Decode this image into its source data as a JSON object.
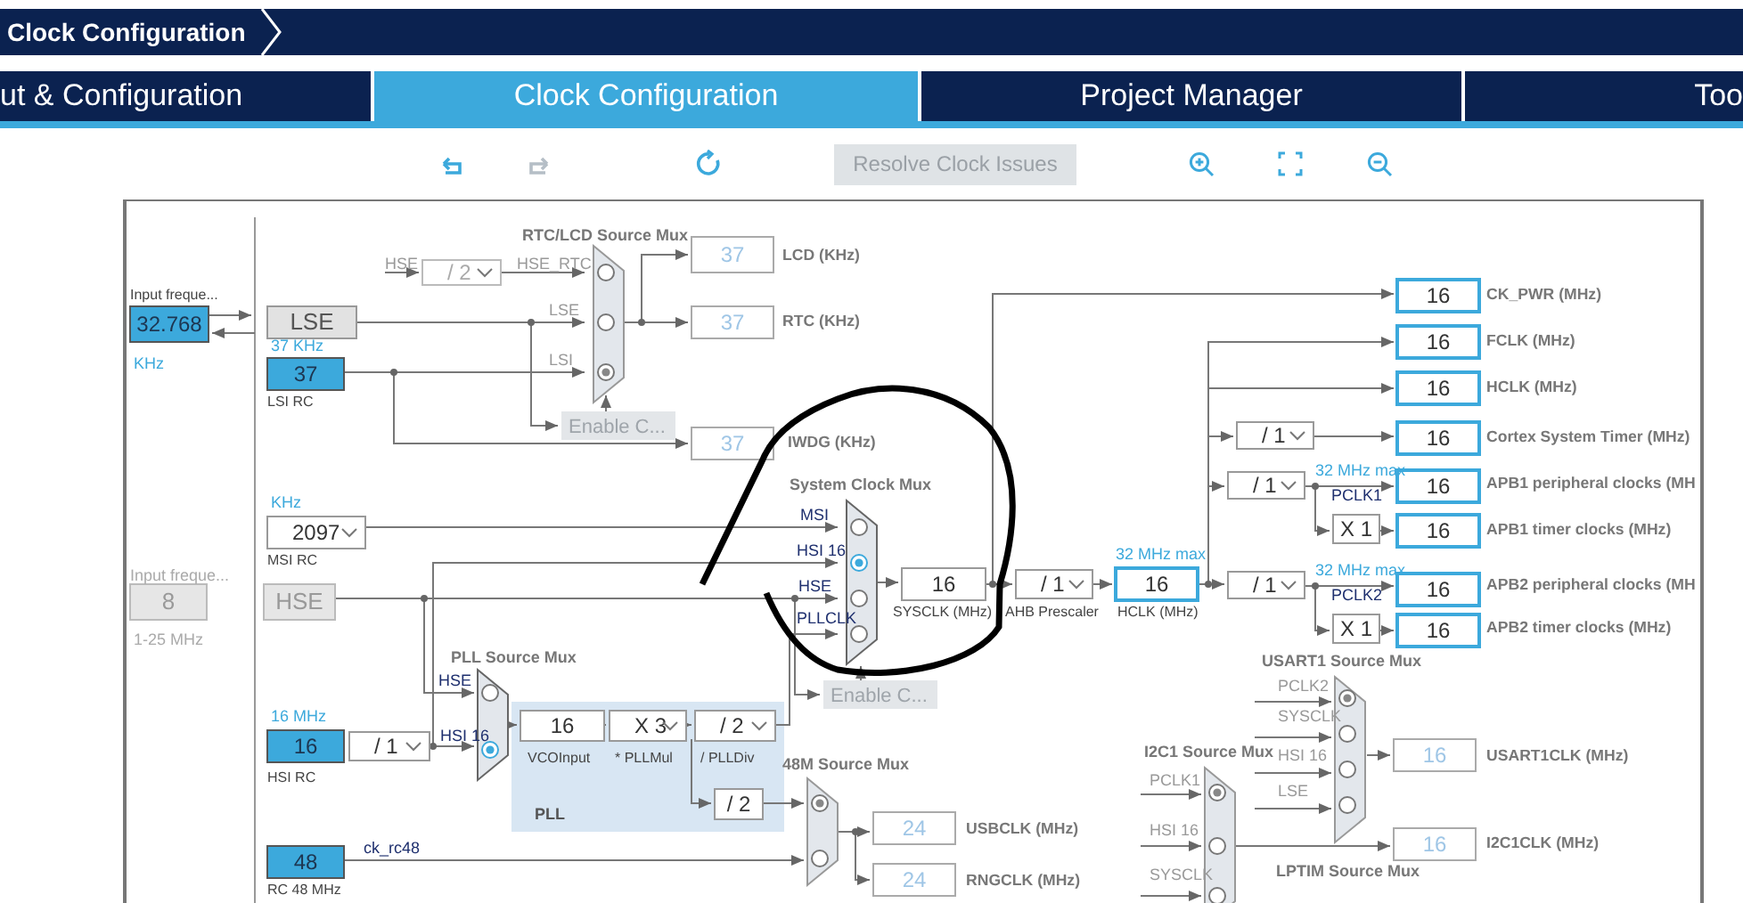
{
  "breadcrumb": "Clock Configuration",
  "tabs": [
    {
      "label": "ut & Configuration",
      "selected": false
    },
    {
      "label": "Clock Configuration",
      "selected": true
    },
    {
      "label": "Project Manager",
      "selected": false
    },
    {
      "label": "Too",
      "selected": false
    }
  ],
  "toolbar": {
    "icons": [
      {
        "kind": "undo",
        "disabled": false
      },
      {
        "kind": "redo",
        "disabled": true
      },
      {
        "kind": "refresh",
        "disabled": false
      },
      {
        "kind": "zoom_in",
        "disabled": false
      },
      {
        "kind": "fit",
        "disabled": false
      },
      {
        "kind": "zoom_out",
        "disabled": false
      }
    ],
    "resolve_button": {
      "label": "Resolve Clock Issues",
      "disabled": true
    }
  },
  "diagram": {
    "boxes": [
      {
        "value": "32.768",
        "kind": "source"
      },
      {
        "value": "LSE",
        "kind": "block"
      },
      {
        "value": "37",
        "kind": "source"
      },
      {
        "value": "37",
        "kind": "inactive"
      },
      {
        "value": "37",
        "kind": "inactive"
      },
      {
        "value": "37",
        "kind": "inactive"
      },
      {
        "value": "2097",
        "kind": "dropdown"
      },
      {
        "value": "8",
        "kind": "disabled"
      },
      {
        "value": "HSE",
        "kind": "disabled"
      },
      {
        "value": "16",
        "kind": "source"
      },
      {
        "value": "/ 1",
        "kind": "dropdown"
      },
      {
        "value": "16",
        "kind": "plain"
      },
      {
        "value": "X 3",
        "kind": "dropdown"
      },
      {
        "value": "/ 2",
        "kind": "dropdown"
      },
      {
        "value": "/ 2",
        "kind": "plain"
      },
      {
        "value": "48",
        "kind": "source"
      },
      {
        "value": "24",
        "kind": "inactive"
      },
      {
        "value": "24",
        "kind": "inactive"
      },
      {
        "value": "16",
        "kind": "plain"
      },
      {
        "value": "/ 1",
        "kind": "dropdown"
      },
      {
        "value": "16",
        "kind": "output"
      },
      {
        "value": "/ 1",
        "kind": "dropdown"
      },
      {
        "value": "/ 1",
        "kind": "dropdown"
      },
      {
        "value": "/ 1",
        "kind": "dropdown"
      },
      {
        "value": "X 1",
        "kind": "plain"
      },
      {
        "value": "X 1",
        "kind": "plain"
      },
      {
        "value": "16",
        "kind": "output"
      },
      {
        "value": "16",
        "kind": "output"
      },
      {
        "value": "16",
        "kind": "output"
      },
      {
        "value": "16",
        "kind": "output"
      },
      {
        "value": "16",
        "kind": "output"
      },
      {
        "value": "16",
        "kind": "output"
      },
      {
        "value": "16",
        "kind": "output"
      },
      {
        "value": "16",
        "kind": "output"
      },
      {
        "value": "16",
        "kind": "inactive"
      },
      {
        "value": "16",
        "kind": "inactive"
      },
      {
        "value": "/ 2",
        "kind": "dropdown_off"
      }
    ],
    "labels": [
      {
        "text": "RTC/LCD Source Mux",
        "kind": "title"
      },
      {
        "text": "System Clock Mux",
        "kind": "title"
      },
      {
        "text": "PLL Source Mux",
        "kind": "title"
      },
      {
        "text": "48M Source Mux",
        "kind": "title"
      },
      {
        "text": "USART1 Source Mux",
        "kind": "title"
      },
      {
        "text": "I2C1 Source Mux",
        "kind": "title"
      },
      {
        "text": "LPTIM Source Mux",
        "kind": "title"
      },
      {
        "text": "LCD (KHz)",
        "kind": "output"
      },
      {
        "text": "RTC (KHz)",
        "kind": "output"
      },
      {
        "text": "IWDG (KHz)",
        "kind": "output"
      },
      {
        "text": "CK_PWR (MHz)",
        "kind": "output"
      },
      {
        "text": "FCLK (MHz)",
        "kind": "output"
      },
      {
        "text": "HCLK (MHz)",
        "kind": "output"
      },
      {
        "text": "Cortex System Timer (MHz)",
        "kind": "output"
      },
      {
        "text": "APB1 peripheral clocks (MH",
        "kind": "output"
      },
      {
        "text": "APB1 timer clocks (MHz)",
        "kind": "output"
      },
      {
        "text": "APB2 peripheral clocks (MH",
        "kind": "output"
      },
      {
        "text": "APB2 timer clocks (MHz)",
        "kind": "output"
      },
      {
        "text": "USBCLK (MHz)",
        "kind": "output"
      },
      {
        "text": "RNGCLK (MHz)",
        "kind": "output"
      },
      {
        "text": "USART1CLK (MHz)",
        "kind": "output"
      },
      {
        "text": "I2C1CLK (MHz)",
        "kind": "output"
      },
      {
        "text": "MSI",
        "kind": "signal"
      },
      {
        "text": "HSI 16",
        "kind": "signal"
      },
      {
        "text": "HSE",
        "kind": "signal"
      },
      {
        "text": "PLLCLK",
        "kind": "signal"
      },
      {
        "text": "HSE",
        "kind": "signal"
      },
      {
        "text": "HSI 16",
        "kind": "signal"
      },
      {
        "text": "PCLK1",
        "kind": "signal"
      },
      {
        "text": "PCLK2",
        "kind": "signal"
      },
      {
        "text": "ck_rc48",
        "kind": "signal"
      },
      {
        "text": "PLL",
        "kind": "pll"
      },
      {
        "text": "HSE",
        "kind": "signal_off"
      },
      {
        "text": "HSE_RTC",
        "kind": "signal_off"
      },
      {
        "text": "LSE",
        "kind": "signal_off"
      },
      {
        "text": "LSI",
        "kind": "signal_off"
      },
      {
        "text": "PCLK2",
        "kind": "signal_off"
      },
      {
        "text": "SYSCLK",
        "kind": "signal_off"
      },
      {
        "text": "HSI 16",
        "kind": "signal_off"
      },
      {
        "text": "LSE",
        "kind": "signal_off"
      },
      {
        "text": "PCLK1",
        "kind": "signal_off"
      },
      {
        "text": "HSI 16",
        "kind": "signal_off"
      },
      {
        "text": "SYSCLK",
        "kind": "signal_off"
      },
      {
        "text": "LSI RC",
        "kind": "caption"
      },
      {
        "text": "MSI RC",
        "kind": "caption"
      },
      {
        "text": "HSI RC",
        "kind": "caption"
      },
      {
        "text": "RC 48 MHz",
        "kind": "caption"
      },
      {
        "text": "VCOInput",
        "kind": "caption"
      },
      {
        "text": "* PLLMul",
        "kind": "caption"
      },
      {
        "text": "/ PLLDiv",
        "kind": "caption"
      },
      {
        "text": "SYSCLK (MHz)",
        "kind": "caption"
      },
      {
        "text": "AHB Prescaler",
        "kind": "caption"
      },
      {
        "text": "HCLK (MHz)",
        "kind": "caption"
      },
      {
        "text": "Input freque...",
        "kind": "caption"
      },
      {
        "text": "KHz",
        "kind": "hint"
      },
      {
        "text": "Input freque...",
        "kind": "caption_off"
      },
      {
        "text": "1-25 MHz",
        "kind": "caption_off"
      },
      {
        "text": "37 KHz",
        "kind": "hint"
      },
      {
        "text": "KHz",
        "kind": "hint"
      },
      {
        "text": "16 MHz",
        "kind": "hint"
      },
      {
        "text": "32 MHz max",
        "kind": "hint"
      },
      {
        "text": "32 MHz max",
        "kind": "hint"
      },
      {
        "text": "32 MHz max",
        "kind": "hint"
      }
    ],
    "enable_buttons": [
      {
        "label": "Enable C...",
        "disabled": true
      },
      {
        "label": "Enable C...",
        "disabled": true
      }
    ],
    "muxes": [
      {
        "active": false,
        "inputs": [
          {
            "selected": false
          },
          {
            "selected": false
          },
          {
            "selected": true
          }
        ]
      },
      {
        "active": true,
        "inputs": [
          {
            "selected": false
          },
          {
            "selected": true
          },
          {
            "selected": false
          },
          {
            "selected": false
          }
        ]
      },
      {
        "active": true,
        "inputs": [
          {
            "selected": false
          },
          {
            "selected": true
          }
        ]
      },
      {
        "active": false,
        "inputs": [
          {
            "selected": true
          },
          {
            "selected": false
          }
        ]
      },
      {
        "active": false,
        "inputs": [
          {
            "selected": true
          },
          {
            "selected": false
          },
          {
            "selected": false
          },
          {
            "selected": false
          }
        ]
      },
      {
        "active": false,
        "inputs": [
          {
            "selected": true
          },
          {
            "selected": false
          },
          {
            "selected": false
          }
        ]
      }
    ]
  }
}
